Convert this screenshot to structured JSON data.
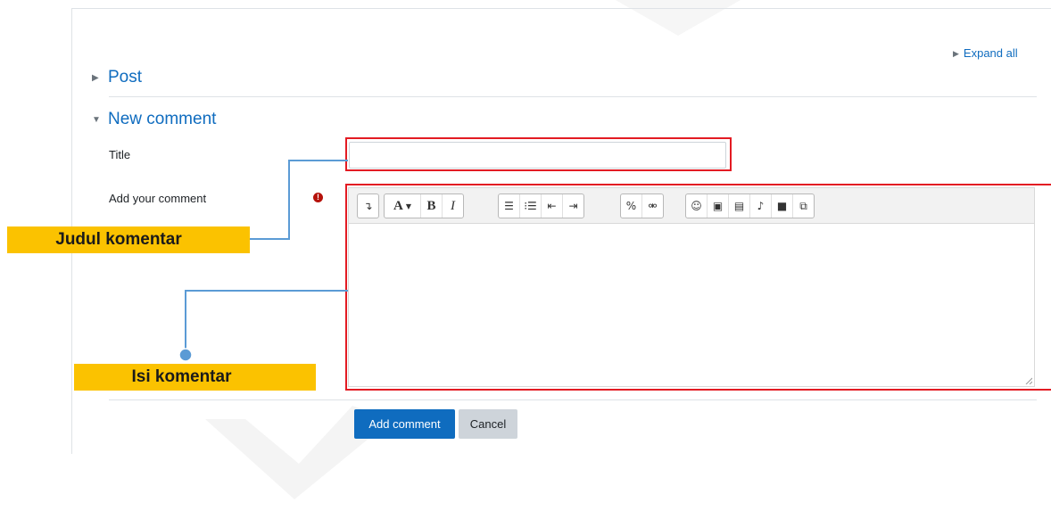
{
  "header": {
    "expand_all_label": "Expand all"
  },
  "sections": {
    "post_label": "Post",
    "new_comment_label": "New comment"
  },
  "form": {
    "title_label": "Title",
    "title_value": "",
    "comment_label": "Add your comment",
    "required_icon": "exclamation-circle-icon"
  },
  "editor": {
    "toolbar_groups": [
      [
        "collapse-icon"
      ],
      [
        "font-style-icon",
        "bold-icon",
        "italic-icon"
      ],
      [
        "unordered-list-icon",
        "ordered-list-icon",
        "outdent-icon",
        "indent-icon"
      ],
      [
        "link-icon",
        "unlink-icon"
      ],
      [
        "emoji-icon",
        "image-icon",
        "media-icon",
        "record-audio-icon",
        "record-video-icon",
        "manage-files-icon"
      ]
    ],
    "content": ""
  },
  "actions": {
    "submit_label": "Add comment",
    "cancel_label": "Cancel"
  },
  "callouts": {
    "title_callout": "Judul komentar",
    "content_callout": "Isi komentar"
  },
  "colors": {
    "primary": "#0f6cbf",
    "highlight_border": "#e31b23",
    "callout_bg": "#fbc200",
    "connector": "#5b9bd5"
  }
}
